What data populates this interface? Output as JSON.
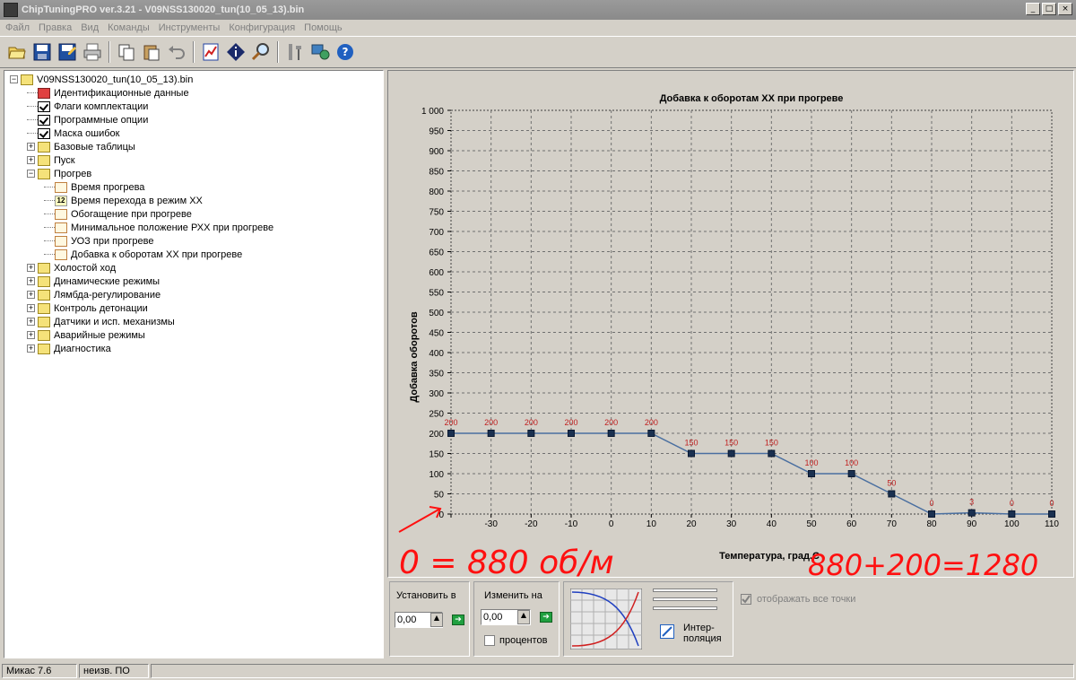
{
  "window": {
    "title": "ChipTuningPRO ver.3.21 - V09NSS130020_tun(10_05_13).bin",
    "btn_min": "_",
    "btn_max": "□",
    "btn_close": "×"
  },
  "menu": [
    "Файл",
    "Правка",
    "Вид",
    "Команды",
    "Инструменты",
    "Конфигурация",
    "Помощь"
  ],
  "tree": {
    "root": "V09NSS130020_tun(10_05_13).bin",
    "items": [
      {
        "label": "Идентификационные данные",
        "icon": "flag-icon",
        "level": 1
      },
      {
        "label": "Флаги комплектации",
        "icon": "check-icon",
        "level": 1
      },
      {
        "label": "Программные опции",
        "icon": "check-icon",
        "level": 1
      },
      {
        "label": "Маска ошибок",
        "icon": "check-icon",
        "level": 1
      },
      {
        "label": "Базовые таблицы",
        "icon": "folder-icon",
        "level": 1,
        "expander": "+"
      },
      {
        "label": "Пуск",
        "icon": "folder-icon",
        "level": 1,
        "expander": "+"
      },
      {
        "label": "Прогрев",
        "icon": "folder-open-icon",
        "level": 1,
        "expander": "−"
      },
      {
        "label": "Время прогрева",
        "icon": "chart-icon",
        "level": 2
      },
      {
        "label": "Время перехода в режим ХХ",
        "icon": "number-icon",
        "level": 2
      },
      {
        "label": "Обогащение при прогреве",
        "icon": "chart-icon",
        "level": 2
      },
      {
        "label": "Минимальное положение РХХ при прогреве",
        "icon": "chart-icon",
        "level": 2
      },
      {
        "label": "УОЗ при прогреве",
        "icon": "chart-icon",
        "level": 2
      },
      {
        "label": "Добавка к оборотам ХХ при прогреве",
        "icon": "chart-icon",
        "level": 2
      },
      {
        "label": "Холостой ход",
        "icon": "folder-icon",
        "level": 1,
        "expander": "+"
      },
      {
        "label": "Динамические режимы",
        "icon": "folder-icon",
        "level": 1,
        "expander": "+"
      },
      {
        "label": "Лямбда-регулирование",
        "icon": "folder-icon",
        "level": 1,
        "expander": "+"
      },
      {
        "label": "Контроль детонации",
        "icon": "folder-icon",
        "level": 1,
        "expander": "+"
      },
      {
        "label": "Датчики и исп. механизмы",
        "icon": "folder-icon",
        "level": 1,
        "expander": "+"
      },
      {
        "label": "Аварийные режимы",
        "icon": "folder-icon",
        "level": 1,
        "expander": "+"
      },
      {
        "label": "Диагностика",
        "icon": "folder-icon",
        "level": 1,
        "expander": "+"
      }
    ]
  },
  "chart_data": {
    "type": "line",
    "title": "Добавка к оборотам ХХ при прогреве",
    "xlabel": "Температура, град.С",
    "ylabel": "Добавка оборотов",
    "categories": [
      "-40",
      "-30",
      "-20",
      "-10",
      "0",
      "10",
      "20",
      "30",
      "40",
      "50",
      "60",
      "70",
      "80",
      "90",
      "100",
      "110"
    ],
    "x_tick_labels": [
      "",
      "-30",
      "-20",
      "-10",
      "0",
      "10",
      "20",
      "30",
      "40",
      "50",
      "60",
      "70",
      "80",
      "90",
      "100",
      "110"
    ],
    "values": [
      200,
      200,
      200,
      200,
      200,
      200,
      150,
      150,
      150,
      100,
      100,
      50,
      0,
      3,
      0,
      0
    ],
    "ylim": [
      0,
      1000
    ],
    "yticks": [
      "0",
      "50",
      "100",
      "150",
      "200",
      "250",
      "300",
      "350",
      "400",
      "450",
      "500",
      "550",
      "600",
      "650",
      "700",
      "750",
      "800",
      "850",
      "900",
      "950",
      "1 000"
    ],
    "grid": true,
    "line_color": "#4a6fa0",
    "label_color": "#c02020"
  },
  "annotations": {
    "left": "0 = 880 об/м",
    "right": "880+200=1280",
    "color": "#ff1010"
  },
  "controls": {
    "set_label": "Установить в",
    "set_value": "0,00",
    "change_label": "Изменить на",
    "change_value": "0,00",
    "percent_label": "процентов",
    "interp_label_1": "Интер-",
    "interp_label_2": "поляция",
    "show_all_label": "отображать все точки"
  },
  "status": {
    "left": "Микас 7.6",
    "right": "неизв. ПО"
  }
}
